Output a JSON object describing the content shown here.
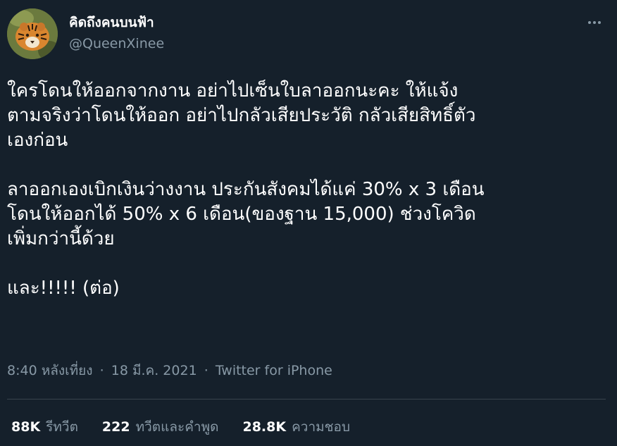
{
  "author": {
    "display_name": "คิดถึงคนบนฟ้า",
    "handle": "@QueenXinee",
    "avatar_icon": "tiger-avatar"
  },
  "more_icon": "more-options-icon",
  "tweet": {
    "text": "ใครโดนให้ออกจากงาน อย่าไปเซ็นใบลาออกนะคะ ให้แจ้ง\nตามจริงว่าโดนให้ออก อย่าไปกลัวเสียประวัติ กลัวเสียสิทธิ์ตัว\nเองก่อน\n\nลาออกเองเบิกเงินว่างงาน ประกันสังคมได้แค่ 30% x 3 เดือน\nโดนให้ออกได้ 50% x 6 เดือน(ของฐาน 15,000) ช่วงโควิด\nเพิ่มกว่านี้ด้วย\n\nและ!!!!! (ต่อ)"
  },
  "meta": {
    "time": "8:40 หลังเที่ยง",
    "separator": "·",
    "date": "18 มี.ค. 2021",
    "source": "Twitter for iPhone"
  },
  "stats": {
    "retweets_count": "88K",
    "retweets_label": "รีทวีต",
    "quotes_count": "222",
    "quotes_label": "ทวีตและคำพูด",
    "likes_count": "28.8K",
    "likes_label": "ความชอบ"
  },
  "colors": {
    "background": "#15202b",
    "text": "#ffffff",
    "secondary": "#8899a6",
    "divider": "#38444d"
  }
}
